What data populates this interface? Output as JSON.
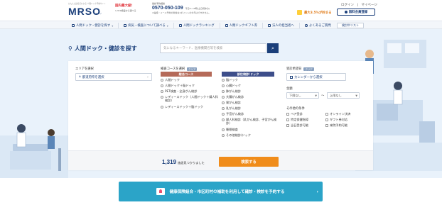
{
  "header": {
    "tagline": "かんたん比較でわかる 人間ドック予約サイト",
    "logo": "MRSO",
    "logo_sub": "マーソ",
    "facility_title": "国内最大級!",
    "facility_count": "1,319施設から選べる",
    "phone_label_small": "健診予約相談",
    "phone_label": "0570-",
    "phone_number": "0570-050-109",
    "phone_hours": "平日9~18時(土日祝休み)",
    "phone_note": "※電話・メール予約の場合は1ポイントの付与はできません。",
    "links": [
      "ログイン",
      "マイページ"
    ],
    "promo": "最大3.5%が貯まる",
    "register_button": "無料会員登録"
  },
  "nav": {
    "items": [
      {
        "label": "人間ドック・健診を探す"
      },
      {
        "label": "病気・検査について調べる"
      },
      {
        "label": "人間ドックランキング"
      },
      {
        "label": "人間ドックギフト券"
      },
      {
        "label": "法人の担当者へ"
      },
      {
        "label": "よくあるご質問"
      }
    ],
    "wishlist_button": "検討中リスト"
  },
  "search": {
    "title": "人間ドック・健診を探す",
    "placeholder": "気になるキーワード、医療機関名等を検索"
  },
  "area": {
    "label": "エリアを選択",
    "button": "都道府県を選択"
  },
  "course": {
    "label": "検査コースを選択",
    "clear": "クリア",
    "general_head": "総合コース",
    "general_items": [
      "人間ドック",
      "人間ドック＋脳ドック",
      "PET検査・全身がん検診",
      "レディースドック（人間ドック＋婦人科検診）",
      "レディースドック＋脳ドック"
    ],
    "specific_head": "部位検診/ドック",
    "specific_items": [
      "脳ドック",
      "心臓ドック",
      "肺がん検診",
      "大腸がん検診",
      "胃がん検診",
      "乳がん検診",
      "子宮がん検診",
      "婦人科検診（乳がん検診、子宮がん検診）",
      "睡眠検査",
      "その他検診/ドック"
    ]
  },
  "date": {
    "label": "受診希望日",
    "clear": "クリア",
    "button": "カレンダーから選択"
  },
  "budget": {
    "label": "金額",
    "min": "下限なし",
    "sep": "〜",
    "max": "上限なし"
  },
  "other": {
    "label": "その他の条件",
    "items": [
      "ペア受診",
      "オンライン決済",
      "特定保健指導",
      "ギフト券対応",
      "当日受診可能",
      "来院予約可能"
    ]
  },
  "results": {
    "count": "1,319",
    "text": "施設見つかりました",
    "button": "検索する"
  },
  "banner": {
    "text": "健康保険組合・市区町村の補助を利用して確診・検診を予約する"
  },
  "colors": {
    "brand": "#1b3f7a",
    "general_head": "#b56a59",
    "specific_head": "#3d4e8a",
    "cta": "#f08c1a",
    "banner": "#2ba4c8"
  }
}
